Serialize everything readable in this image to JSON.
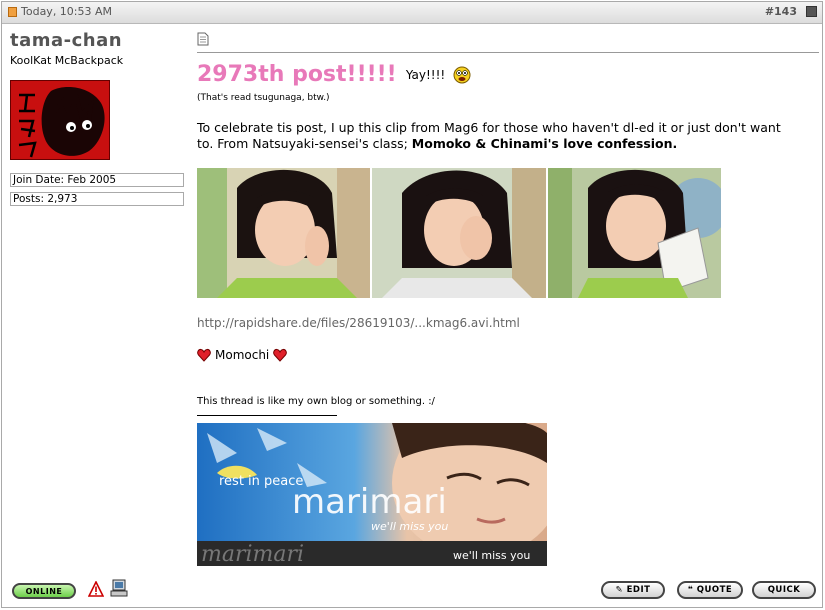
{
  "header": {
    "date": "Today, 10:53 AM",
    "post_number": "#143"
  },
  "user": {
    "name": "tama-chan",
    "title": "KoolKat McBackpack",
    "join_date": "Join Date: Feb 2005",
    "posts": "Posts: 2,973"
  },
  "post": {
    "headline": "2973th post!!!!!",
    "yay": "Yay!!!!",
    "note": "(That's read tsugunaga, btw.)",
    "para_start": "To celebrate tis post, I up this clip from Mag6 for those who haven't dl-ed it or just don't want to. From Natsuyaki-sensei's class;",
    "para_bold": "Momoko & Chinami's love confession.",
    "link": "http://rapidshare.de/files/28619103/...kmag6.avi.html",
    "sign": "Momochi"
  },
  "signature": {
    "blog_line": "This thread is like my own blog or something. :/",
    "banner_rest": "rest in peace",
    "banner_name": "marimari",
    "banner_miss": "we'll miss you",
    "banner_bottom_name": "marimari",
    "banner_bottom_miss": "we'll miss you"
  },
  "footer": {
    "online": "ONLINE",
    "edit": "EDIT",
    "quote": "QUOTE",
    "quick": "QUICK"
  },
  "colors": {
    "headline": "#e879b9",
    "header_bg": "#e6e6e6",
    "avatar_bg": "#c80f0f",
    "online_green": "#6dcf4a"
  },
  "icons": [
    "post-icon",
    "checkbox-icon",
    "message-icon",
    "smiley-icon",
    "heart-icon",
    "report-icon",
    "computer-icon",
    "edit-icon",
    "quote-icon"
  ]
}
